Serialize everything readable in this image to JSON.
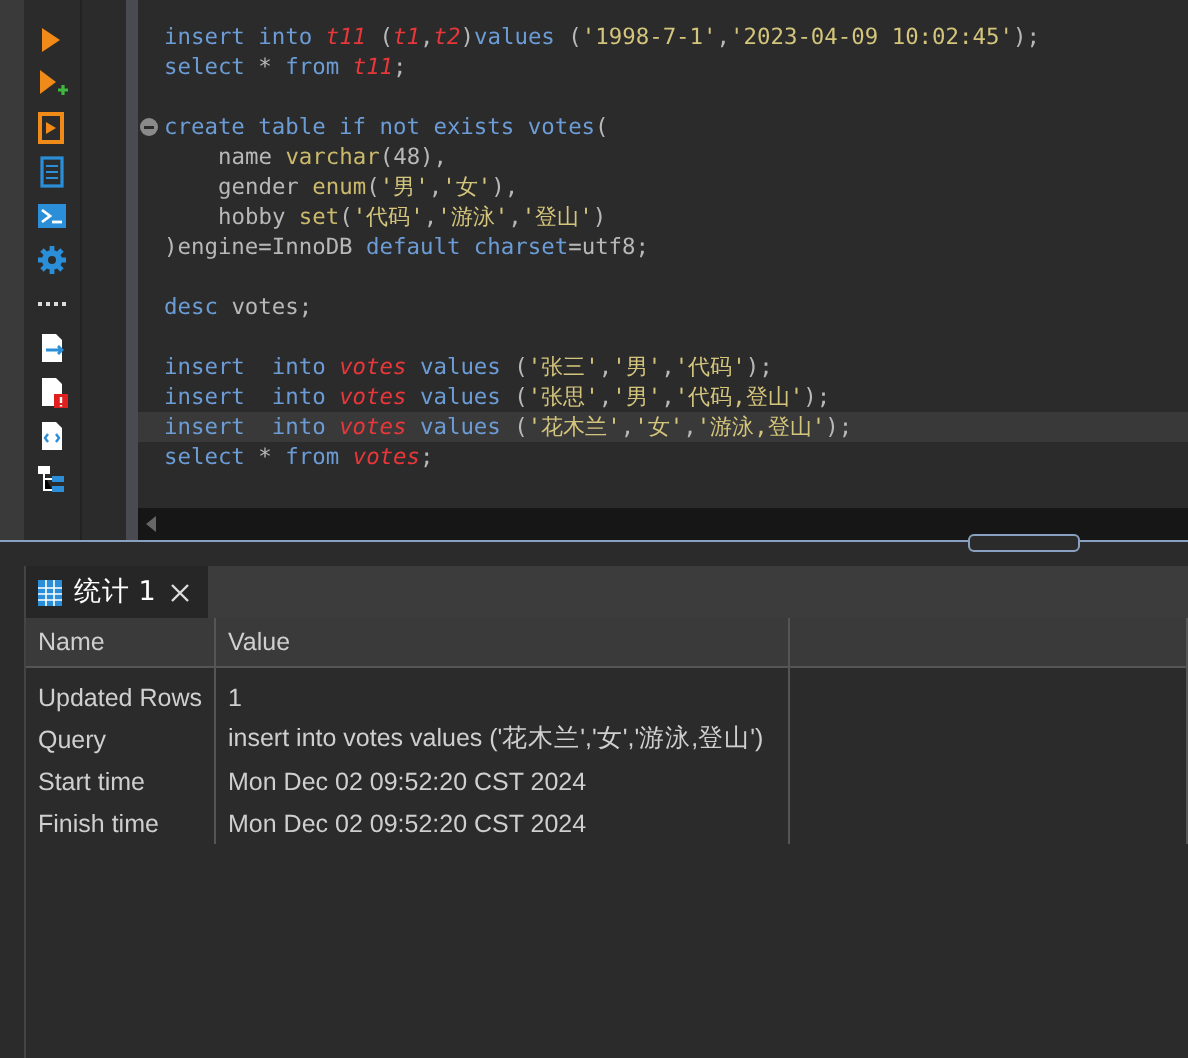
{
  "editor": {
    "blocks": [
      {
        "lines": [
          {
            "indented": false,
            "current": false,
            "foldable": false,
            "tokens": [
              {
                "kind": "keyword",
                "text": "insert into "
              },
              {
                "kind": "ident",
                "text": "t11"
              },
              {
                "kind": "plain",
                "text": " ("
              },
              {
                "kind": "ident",
                "text": "t1"
              },
              {
                "kind": "plain",
                "text": ","
              },
              {
                "kind": "ident",
                "text": "t2"
              },
              {
                "kind": "plain",
                "text": ")"
              },
              {
                "kind": "keyword",
                "text": "values "
              },
              {
                "kind": "plain",
                "text": "("
              },
              {
                "kind": "string",
                "text": "'1998-7-1'"
              },
              {
                "kind": "plain",
                "text": ","
              },
              {
                "kind": "string",
                "text": "'2023-04-09 10:02:45'"
              },
              {
                "kind": "plain",
                "text": ");"
              }
            ]
          },
          {
            "indented": false,
            "current": false,
            "foldable": false,
            "tokens": [
              {
                "kind": "keyword",
                "text": "select "
              },
              {
                "kind": "plain",
                "text": "* "
              },
              {
                "kind": "keyword",
                "text": "from "
              },
              {
                "kind": "ident",
                "text": "t11"
              },
              {
                "kind": "plain",
                "text": ";"
              }
            ]
          }
        ]
      },
      {
        "lines": [
          {
            "indented": false,
            "current": false,
            "foldable": true,
            "tokens": [
              {
                "kind": "keyword",
                "text": "create table if not exists votes"
              },
              {
                "kind": "plain",
                "text": "("
              }
            ]
          },
          {
            "indented": true,
            "current": false,
            "foldable": false,
            "tokens": [
              {
                "kind": "plain",
                "text": "name "
              },
              {
                "kind": "func",
                "text": "varchar"
              },
              {
                "kind": "plain",
                "text": "(48),"
              }
            ]
          },
          {
            "indented": true,
            "current": false,
            "foldable": false,
            "tokens": [
              {
                "kind": "plain",
                "text": "gender "
              },
              {
                "kind": "func",
                "text": "enum"
              },
              {
                "kind": "plain",
                "text": "("
              },
              {
                "kind": "string",
                "text": "'男'"
              },
              {
                "kind": "plain",
                "text": ","
              },
              {
                "kind": "string",
                "text": "'女'"
              },
              {
                "kind": "plain",
                "text": "),"
              }
            ]
          },
          {
            "indented": true,
            "current": false,
            "foldable": false,
            "tokens": [
              {
                "kind": "plain",
                "text": "hobby "
              },
              {
                "kind": "func",
                "text": "set"
              },
              {
                "kind": "plain",
                "text": "("
              },
              {
                "kind": "string",
                "text": "'代码'"
              },
              {
                "kind": "plain",
                "text": ","
              },
              {
                "kind": "string",
                "text": "'游泳'"
              },
              {
                "kind": "plain",
                "text": ","
              },
              {
                "kind": "string",
                "text": "'登山'"
              },
              {
                "kind": "plain",
                "text": ")"
              }
            ]
          },
          {
            "indented": false,
            "current": false,
            "foldable": false,
            "tokens": [
              {
                "kind": "plain",
                "text": ")engine=InnoDB "
              },
              {
                "kind": "keyword",
                "text": "default charset"
              },
              {
                "kind": "plain",
                "text": "=utf8;"
              }
            ]
          }
        ]
      },
      {
        "lines": [
          {
            "indented": false,
            "current": false,
            "foldable": false,
            "tokens": [
              {
                "kind": "keyword",
                "text": "desc "
              },
              {
                "kind": "plain",
                "text": "votes;"
              }
            ]
          }
        ]
      },
      {
        "lines": [
          {
            "indented": false,
            "current": false,
            "foldable": false,
            "tokens": [
              {
                "kind": "keyword",
                "text": "insert  into "
              },
              {
                "kind": "ident",
                "text": "votes"
              },
              {
                "kind": "keyword",
                "text": " values "
              },
              {
                "kind": "plain",
                "text": "("
              },
              {
                "kind": "string",
                "text": "'张三'"
              },
              {
                "kind": "plain",
                "text": ","
              },
              {
                "kind": "string",
                "text": "'男'"
              },
              {
                "kind": "plain",
                "text": ","
              },
              {
                "kind": "string",
                "text": "'代码'"
              },
              {
                "kind": "plain",
                "text": ");"
              }
            ]
          },
          {
            "indented": false,
            "current": false,
            "foldable": false,
            "tokens": [
              {
                "kind": "keyword",
                "text": "insert  into "
              },
              {
                "kind": "ident",
                "text": "votes"
              },
              {
                "kind": "keyword",
                "text": " values "
              },
              {
                "kind": "plain",
                "text": "("
              },
              {
                "kind": "string",
                "text": "'张思'"
              },
              {
                "kind": "plain",
                "text": ","
              },
              {
                "kind": "string",
                "text": "'男'"
              },
              {
                "kind": "plain",
                "text": ","
              },
              {
                "kind": "string",
                "text": "'代码,登山'"
              },
              {
                "kind": "plain",
                "text": ");"
              }
            ]
          },
          {
            "indented": false,
            "current": true,
            "foldable": false,
            "tokens": [
              {
                "kind": "keyword",
                "text": "insert  into "
              },
              {
                "kind": "ident",
                "text": "votes"
              },
              {
                "kind": "keyword",
                "text": " values "
              },
              {
                "kind": "plain",
                "text": "("
              },
              {
                "kind": "string",
                "text": "'花木兰'"
              },
              {
                "kind": "plain",
                "text": ","
              },
              {
                "kind": "string",
                "text": "'女'"
              },
              {
                "kind": "plain",
                "text": ","
              },
              {
                "kind": "string",
                "text": "'游泳,登山'"
              },
              {
                "kind": "plain",
                "text": ");"
              }
            ]
          },
          {
            "indented": false,
            "current": false,
            "foldable": false,
            "tokens": [
              {
                "kind": "keyword",
                "text": "select "
              },
              {
                "kind": "plain",
                "text": "* "
              },
              {
                "kind": "keyword",
                "text": "from "
              },
              {
                "kind": "ident",
                "text": "votes"
              },
              {
                "kind": "plain",
                "text": ";"
              }
            ]
          }
        ]
      }
    ]
  },
  "results": {
    "tabs": [
      {
        "label": "统计 1",
        "selected": true
      }
    ],
    "table": {
      "columns": [
        "Name",
        "Value"
      ],
      "rows": [
        {
          "name": "Updated Rows",
          "value": "1"
        },
        {
          "name": "Query",
          "value": "insert  into votes values ('花木兰','女','游泳,登山')"
        },
        {
          "name": "Start time",
          "value": "Mon Dec 02 09:52:20 CST 2024"
        },
        {
          "name": "Finish time",
          "value": "Mon Dec 02 09:52:20 CST 2024"
        }
      ]
    }
  }
}
